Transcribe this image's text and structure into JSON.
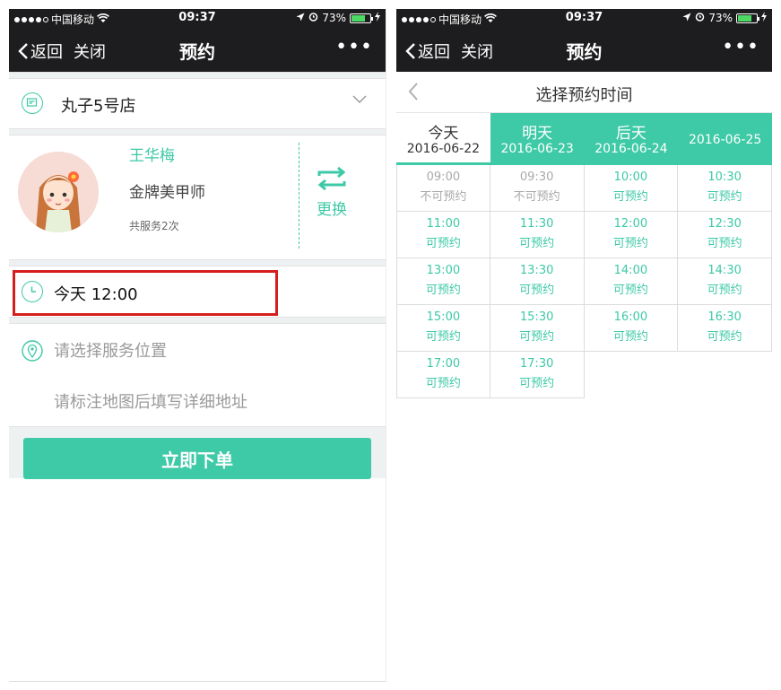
{
  "status_bar": {
    "carrier": "中国移动",
    "time": "09:37",
    "battery": "73%",
    "battery_level": 0.73
  },
  "nav": {
    "back": "返回",
    "close": "关闭",
    "title": "预约",
    "more": "•••"
  },
  "booking": {
    "store": "丸子5号店",
    "technician": {
      "name": "王华梅",
      "title": "金牌美甲师",
      "service_count": "共服务2次",
      "swap_label": "更换"
    },
    "time": "今天 12:00",
    "location_placeholder": "请选择服务位置",
    "address_placeholder": "请标注地图后填写详细地址",
    "submit": "立即下单"
  },
  "picker": {
    "title": "选择预约时间",
    "days": [
      {
        "label": "今天",
        "date": "2016-06-22"
      },
      {
        "label": "明天",
        "date": "2016-06-23"
      },
      {
        "label": "后天",
        "date": "2016-06-24"
      },
      {
        "label": "",
        "date": "2016-06-25"
      }
    ],
    "slots": [
      {
        "time": "09:00",
        "status": "不可预约"
      },
      {
        "time": "09:30",
        "status": "不可预约"
      },
      {
        "time": "10:00",
        "status": "可预约"
      },
      {
        "time": "10:30",
        "status": "可预约"
      },
      {
        "time": "11:00",
        "status": "可预约"
      },
      {
        "time": "11:30",
        "status": "可预约"
      },
      {
        "time": "12:00",
        "status": "可预约"
      },
      {
        "time": "12:30",
        "status": "可预约"
      },
      {
        "time": "13:00",
        "status": "可预约"
      },
      {
        "time": "13:30",
        "status": "可预约"
      },
      {
        "time": "14:00",
        "status": "可预约"
      },
      {
        "time": "14:30",
        "status": "可预约"
      },
      {
        "time": "15:00",
        "status": "可预约"
      },
      {
        "time": "15:30",
        "status": "可预约"
      },
      {
        "time": "16:00",
        "status": "可预约"
      },
      {
        "time": "16:30",
        "status": "可预约"
      },
      {
        "time": "17:00",
        "status": "可预约"
      },
      {
        "time": "17:30",
        "status": "可预约"
      }
    ]
  },
  "colors": {
    "accent": "#3ec9a7",
    "highlight_box": "#d61e1e",
    "nav_bg": "#1d1d1f"
  }
}
